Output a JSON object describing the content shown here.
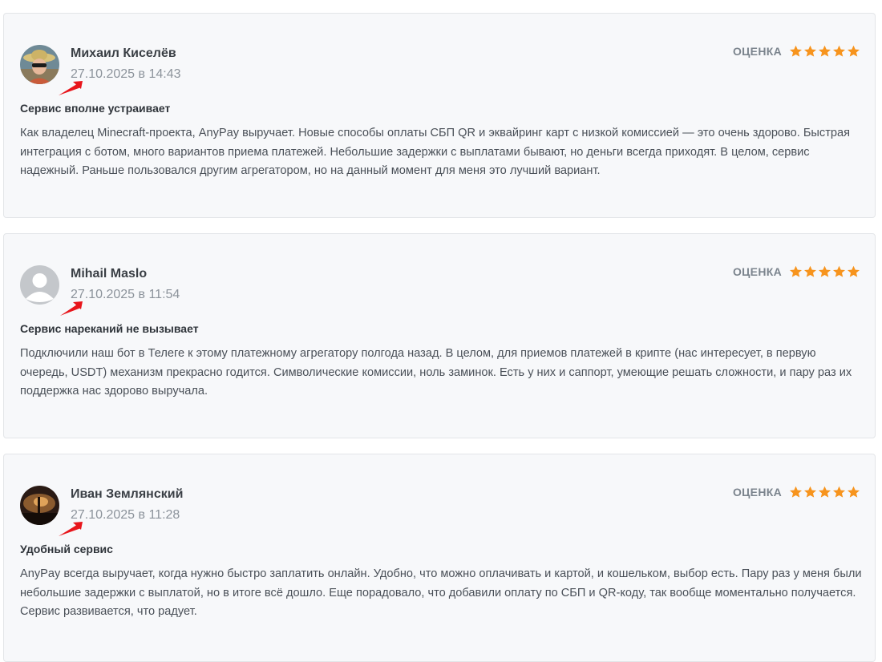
{
  "colors": {
    "star": "#f7941d",
    "marker": "#e8151b",
    "card_bg": "#f7f8fa"
  },
  "reviews": [
    {
      "author": "Михаил Киселёв",
      "date": "27.10.2025 в 14:43",
      "rating_label": "ОЦЕНКА",
      "stars": 5,
      "title": "Сервис вполне устраивает",
      "text": "Как владелец Minecraft-проекта, AnyPay выручает. Новые способы оплаты СБП QR и эквайринг карт с низкой комиссией — это очень здорово. Быстрая интеграция с ботом, много вариантов приема платежей. Небольшие задержки с выплатами бывают, но деньги всегда приходят. В целом, сервис надежный. Раньше пользовался другим агрегатором, но на данный момент для меня это лучший вариант."
    },
    {
      "author": "Mihail Maslo",
      "date": "27.10.2025 в 11:54",
      "rating_label": "ОЦЕНКА",
      "stars": 5,
      "title": "Сервис нареканий не вызывает",
      "text": "Подключили наш бот в Телеге к этому платежному агрегатору полгода назад. В целом, для приемов платежей в крипте (нас интересует, в первую очередь, USDT) механизм прекрасно годится. Символические комиссии, ноль заминок. Есть у них и саппорт, умеющие решать сложности, и пару раз их поддержка нас здорово выручала."
    },
    {
      "author": "Иван Землянский",
      "date": "27.10.2025 в 11:28",
      "rating_label": "ОЦЕНКА",
      "stars": 5,
      "title": "Удобный сервис",
      "text": "AnyPay всегда выручает, когда нужно быстро заплатить онлайн. Удобно, что можно оплачивать и картой, и кошельком, выбор есть. Пару раз у меня были небольшие задержки с выплатой, но в итоге всё дошло. Еще порадовало, что добавили оплату по СБП и QR-коду, так вообще моментально получается. Сервис развивается, что радует."
    }
  ]
}
